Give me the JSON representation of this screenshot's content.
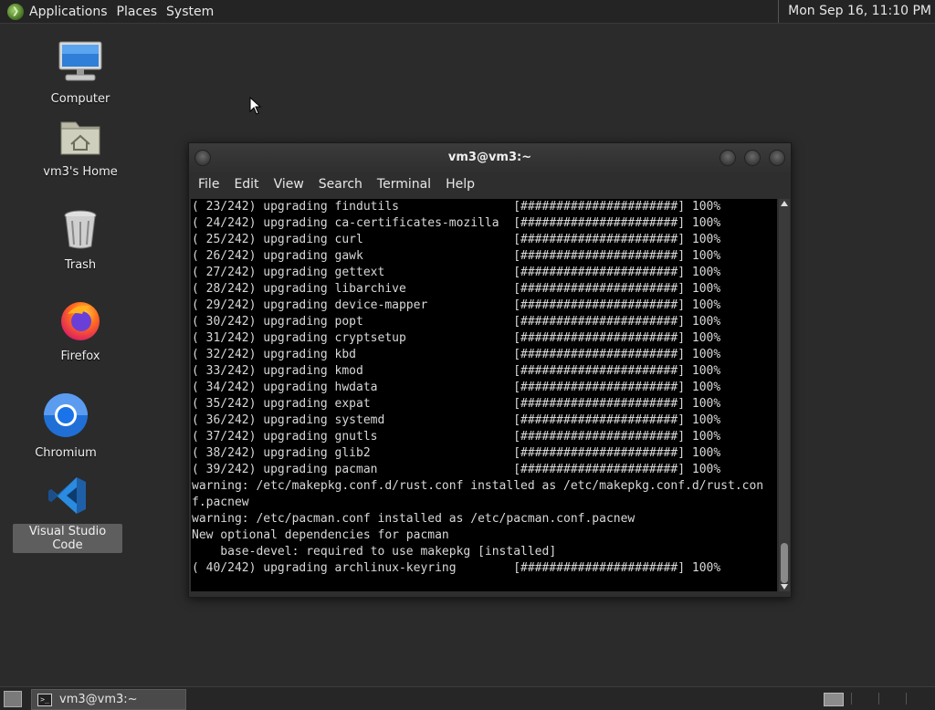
{
  "top_panel": {
    "applications": "Applications",
    "places": "Places",
    "system": "System",
    "clock": "Mon Sep 16, 11:10 PM"
  },
  "desktop": {
    "icons": [
      {
        "label": "Computer",
        "icon": "computer-icon"
      },
      {
        "label": "vm3's Home",
        "icon": "home-folder-icon"
      },
      {
        "label": "Trash",
        "icon": "trash-icon"
      },
      {
        "label": "Firefox",
        "icon": "firefox-icon"
      },
      {
        "label": "Chromium",
        "icon": "chromium-icon"
      },
      {
        "label": "Visual Studio Code",
        "icon": "vscode-icon"
      }
    ]
  },
  "terminal": {
    "title": "vm3@vm3:~",
    "menu": [
      "File",
      "Edit",
      "View",
      "Search",
      "Terminal",
      "Help"
    ],
    "lines": [
      "( 23/242) upgrading findutils                [######################] 100%",
      "( 24/242) upgrading ca-certificates-mozilla  [######################] 100%",
      "( 25/242) upgrading curl                     [######################] 100%",
      "( 26/242) upgrading gawk                     [######################] 100%",
      "( 27/242) upgrading gettext                  [######################] 100%",
      "( 28/242) upgrading libarchive               [######################] 100%",
      "( 29/242) upgrading device-mapper            [######################] 100%",
      "( 30/242) upgrading popt                     [######################] 100%",
      "( 31/242) upgrading cryptsetup               [######################] 100%",
      "( 32/242) upgrading kbd                      [######################] 100%",
      "( 33/242) upgrading kmod                     [######################] 100%",
      "( 34/242) upgrading hwdata                   [######################] 100%",
      "( 35/242) upgrading expat                    [######################] 100%",
      "( 36/242) upgrading systemd                  [######################] 100%",
      "( 37/242) upgrading gnutls                   [######################] 100%",
      "( 38/242) upgrading glib2                    [######################] 100%",
      "( 39/242) upgrading pacman                   [######################] 100%",
      "warning: /etc/makepkg.conf.d/rust.conf installed as /etc/makepkg.conf.d/rust.con",
      "f.pacnew",
      "warning: /etc/pacman.conf installed as /etc/pacman.conf.pacnew",
      "New optional dependencies for pacman",
      "    base-devel: required to use makepkg [installed]",
      "( 40/242) upgrading archlinux-keyring        [######################] 100%"
    ]
  },
  "taskbar": {
    "window_title": "vm3@vm3:~"
  }
}
